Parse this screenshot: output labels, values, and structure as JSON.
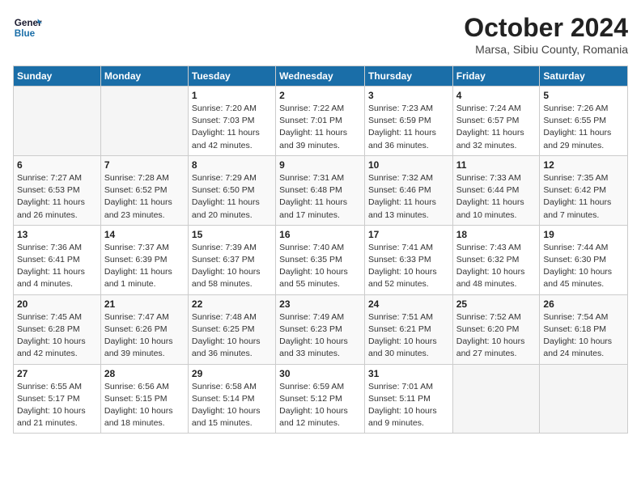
{
  "header": {
    "logo_line1": "General",
    "logo_line2": "Blue",
    "month": "October 2024",
    "location": "Marsa, Sibiu County, Romania"
  },
  "weekdays": [
    "Sunday",
    "Monday",
    "Tuesday",
    "Wednesday",
    "Thursday",
    "Friday",
    "Saturday"
  ],
  "weeks": [
    [
      {
        "day": "",
        "info": ""
      },
      {
        "day": "",
        "info": ""
      },
      {
        "day": "1",
        "info": "Sunrise: 7:20 AM\nSunset: 7:03 PM\nDaylight: 11 hours and 42 minutes."
      },
      {
        "day": "2",
        "info": "Sunrise: 7:22 AM\nSunset: 7:01 PM\nDaylight: 11 hours and 39 minutes."
      },
      {
        "day": "3",
        "info": "Sunrise: 7:23 AM\nSunset: 6:59 PM\nDaylight: 11 hours and 36 minutes."
      },
      {
        "day": "4",
        "info": "Sunrise: 7:24 AM\nSunset: 6:57 PM\nDaylight: 11 hours and 32 minutes."
      },
      {
        "day": "5",
        "info": "Sunrise: 7:26 AM\nSunset: 6:55 PM\nDaylight: 11 hours and 29 minutes."
      }
    ],
    [
      {
        "day": "6",
        "info": "Sunrise: 7:27 AM\nSunset: 6:53 PM\nDaylight: 11 hours and 26 minutes."
      },
      {
        "day": "7",
        "info": "Sunrise: 7:28 AM\nSunset: 6:52 PM\nDaylight: 11 hours and 23 minutes."
      },
      {
        "day": "8",
        "info": "Sunrise: 7:29 AM\nSunset: 6:50 PM\nDaylight: 11 hours and 20 minutes."
      },
      {
        "day": "9",
        "info": "Sunrise: 7:31 AM\nSunset: 6:48 PM\nDaylight: 11 hours and 17 minutes."
      },
      {
        "day": "10",
        "info": "Sunrise: 7:32 AM\nSunset: 6:46 PM\nDaylight: 11 hours and 13 minutes."
      },
      {
        "day": "11",
        "info": "Sunrise: 7:33 AM\nSunset: 6:44 PM\nDaylight: 11 hours and 10 minutes."
      },
      {
        "day": "12",
        "info": "Sunrise: 7:35 AM\nSunset: 6:42 PM\nDaylight: 11 hours and 7 minutes."
      }
    ],
    [
      {
        "day": "13",
        "info": "Sunrise: 7:36 AM\nSunset: 6:41 PM\nDaylight: 11 hours and 4 minutes."
      },
      {
        "day": "14",
        "info": "Sunrise: 7:37 AM\nSunset: 6:39 PM\nDaylight: 11 hours and 1 minute."
      },
      {
        "day": "15",
        "info": "Sunrise: 7:39 AM\nSunset: 6:37 PM\nDaylight: 10 hours and 58 minutes."
      },
      {
        "day": "16",
        "info": "Sunrise: 7:40 AM\nSunset: 6:35 PM\nDaylight: 10 hours and 55 minutes."
      },
      {
        "day": "17",
        "info": "Sunrise: 7:41 AM\nSunset: 6:33 PM\nDaylight: 10 hours and 52 minutes."
      },
      {
        "day": "18",
        "info": "Sunrise: 7:43 AM\nSunset: 6:32 PM\nDaylight: 10 hours and 48 minutes."
      },
      {
        "day": "19",
        "info": "Sunrise: 7:44 AM\nSunset: 6:30 PM\nDaylight: 10 hours and 45 minutes."
      }
    ],
    [
      {
        "day": "20",
        "info": "Sunrise: 7:45 AM\nSunset: 6:28 PM\nDaylight: 10 hours and 42 minutes."
      },
      {
        "day": "21",
        "info": "Sunrise: 7:47 AM\nSunset: 6:26 PM\nDaylight: 10 hours and 39 minutes."
      },
      {
        "day": "22",
        "info": "Sunrise: 7:48 AM\nSunset: 6:25 PM\nDaylight: 10 hours and 36 minutes."
      },
      {
        "day": "23",
        "info": "Sunrise: 7:49 AM\nSunset: 6:23 PM\nDaylight: 10 hours and 33 minutes."
      },
      {
        "day": "24",
        "info": "Sunrise: 7:51 AM\nSunset: 6:21 PM\nDaylight: 10 hours and 30 minutes."
      },
      {
        "day": "25",
        "info": "Sunrise: 7:52 AM\nSunset: 6:20 PM\nDaylight: 10 hours and 27 minutes."
      },
      {
        "day": "26",
        "info": "Sunrise: 7:54 AM\nSunset: 6:18 PM\nDaylight: 10 hours and 24 minutes."
      }
    ],
    [
      {
        "day": "27",
        "info": "Sunrise: 6:55 AM\nSunset: 5:17 PM\nDaylight: 10 hours and 21 minutes."
      },
      {
        "day": "28",
        "info": "Sunrise: 6:56 AM\nSunset: 5:15 PM\nDaylight: 10 hours and 18 minutes."
      },
      {
        "day": "29",
        "info": "Sunrise: 6:58 AM\nSunset: 5:14 PM\nDaylight: 10 hours and 15 minutes."
      },
      {
        "day": "30",
        "info": "Sunrise: 6:59 AM\nSunset: 5:12 PM\nDaylight: 10 hours and 12 minutes."
      },
      {
        "day": "31",
        "info": "Sunrise: 7:01 AM\nSunset: 5:11 PM\nDaylight: 10 hours and 9 minutes."
      },
      {
        "day": "",
        "info": ""
      },
      {
        "day": "",
        "info": ""
      }
    ]
  ]
}
